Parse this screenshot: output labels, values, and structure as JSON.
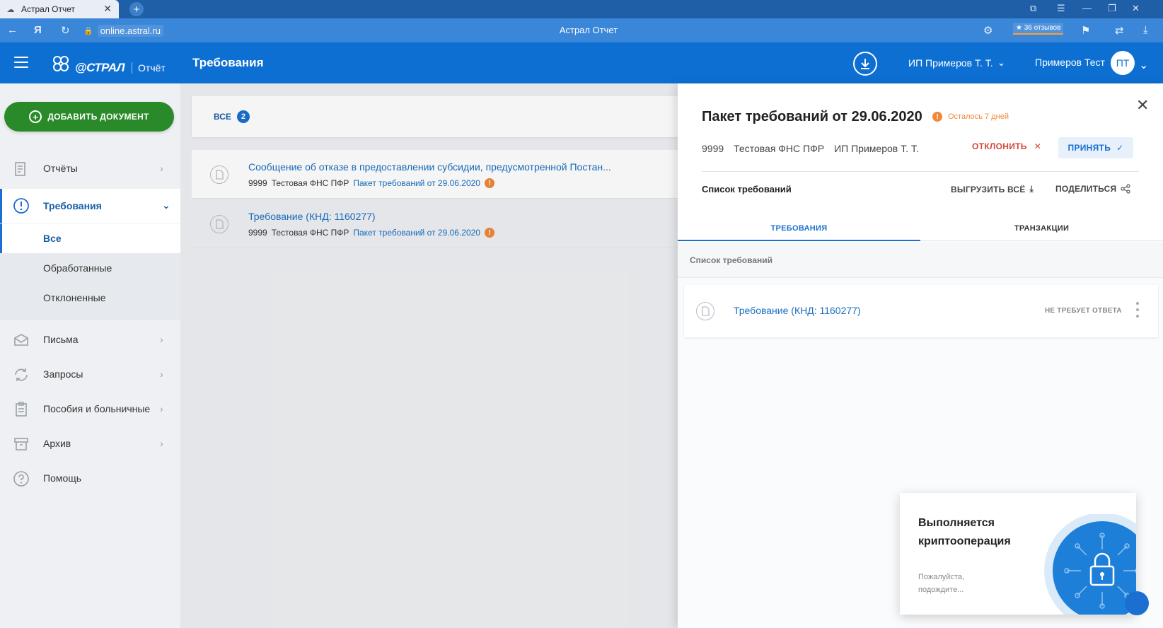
{
  "browser": {
    "tab_title": "Астрал Отчет",
    "tab_close": "✕",
    "new_tab": "+",
    "url": "online.astral.ru",
    "window_title": "Астрал Отчет",
    "reviews_badge": "★ 36 отзывов"
  },
  "header": {
    "logo_text": "@СТРАЛ",
    "logo_sub": "Отчёт",
    "section_title": "Требования",
    "org_name": "ИП Примеров Т. Т.",
    "user_name": "Примеров Тест",
    "avatar_initials": "ПТ"
  },
  "sidebar": {
    "add_button": "ДОБАВИТЬ ДОКУМЕНТ",
    "items": [
      {
        "label": "Отчёты",
        "icon": "report-icon"
      },
      {
        "label": "Требования",
        "icon": "alert-icon"
      },
      {
        "label": "Письма",
        "icon": "mail-icon"
      },
      {
        "label": "Запросы",
        "icon": "refresh-icon"
      },
      {
        "label": "Пособия и больничные",
        "icon": "clipboard-icon"
      },
      {
        "label": "Архив",
        "icon": "archive-icon"
      },
      {
        "label": "Помощь",
        "icon": "help-icon"
      }
    ],
    "sub_items": [
      {
        "label": "Все"
      },
      {
        "label": "Обработанные"
      },
      {
        "label": "Отклоненные"
      }
    ]
  },
  "list": {
    "filter_label": "ВСЕ",
    "filter_count": "2",
    "rows": [
      {
        "title": "Сообщение об отказе в предоставлении субсидии, предусмотренной Постан...",
        "code": "9999",
        "agency": "Тестовая ФНС ПФР",
        "package": "Пакет требований от 29.06.2020"
      },
      {
        "title": "Требование (КНД: 1160277)",
        "code": "9999",
        "agency": "Тестовая ФНС ПФР",
        "package": "Пакет требований от 29.06.2020"
      }
    ]
  },
  "panel": {
    "title": "Пакет требований от 29.06.2020",
    "remaining": "Осталось 7 дней",
    "code": "9999",
    "agency": "Тестовая ФНС ПФР",
    "org": "ИП Примеров Т. Т.",
    "reject_label": "ОТКЛОНИТЬ",
    "accept_label": "ПРИНЯТЬ",
    "requirements_list_label": "Список требований",
    "export_all_label": "ВЫГРУЗИТЬ ВСЁ",
    "share_label": "ПОДЕЛИТЬСЯ",
    "tabs": [
      {
        "label": "ТРЕБОВАНИЯ"
      },
      {
        "label": "ТРАНЗАКЦИИ"
      }
    ],
    "list_header": "Список требований",
    "items": [
      {
        "title": "Требование (КНД: 1160277)",
        "status": "НЕ ТРЕБУЕТ ОТВЕТА"
      }
    ]
  },
  "toast": {
    "title": "Выполняется криптооперация",
    "subtitle": "Пожалуйста, подождите..."
  },
  "colors": {
    "brand_blue": "#0d6fd2",
    "add_green": "#2a8a2a",
    "warning_orange": "#f0883a",
    "reject_red": "#d2453a"
  }
}
